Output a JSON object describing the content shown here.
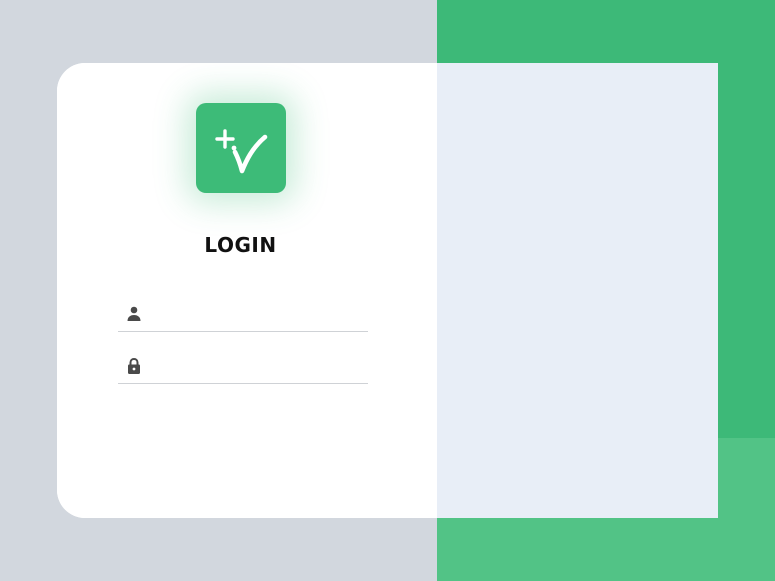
{
  "login": {
    "title": "LOGIN",
    "username_value": "",
    "password_value": ""
  },
  "colors": {
    "accent": "#3db978",
    "accent_light": "#52c386",
    "page_background": "#d2d7de",
    "panel_right": "#e8eef7"
  },
  "icons": {
    "logo": "plus-v-logo-icon",
    "username": "user-icon",
    "password": "lock-icon"
  }
}
